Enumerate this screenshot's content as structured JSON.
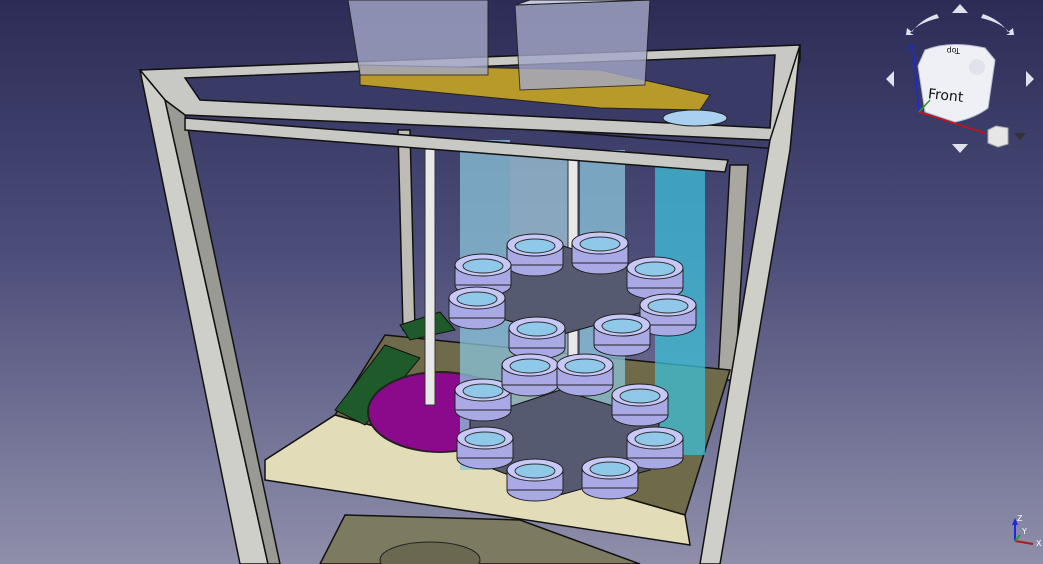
{
  "viewport": {
    "title": "3D view",
    "background_top": "#2c2c57",
    "background_bottom": "#8f8fab"
  },
  "navigation_cube": {
    "front_label": "Front",
    "top_label": "Top",
    "axis_z": "Z",
    "menu_icon": "triangle-down-icon"
  },
  "axis_cross": {
    "x": "X",
    "y": "Y",
    "z": "Z"
  },
  "colors": {
    "frame": "#c8c8c4",
    "shelf": "#6e6a4a",
    "tube": "#7fd6f0",
    "ring": "#b8b8f0",
    "disk": "#8b0a8b",
    "pcb": "#1e5a2a"
  }
}
